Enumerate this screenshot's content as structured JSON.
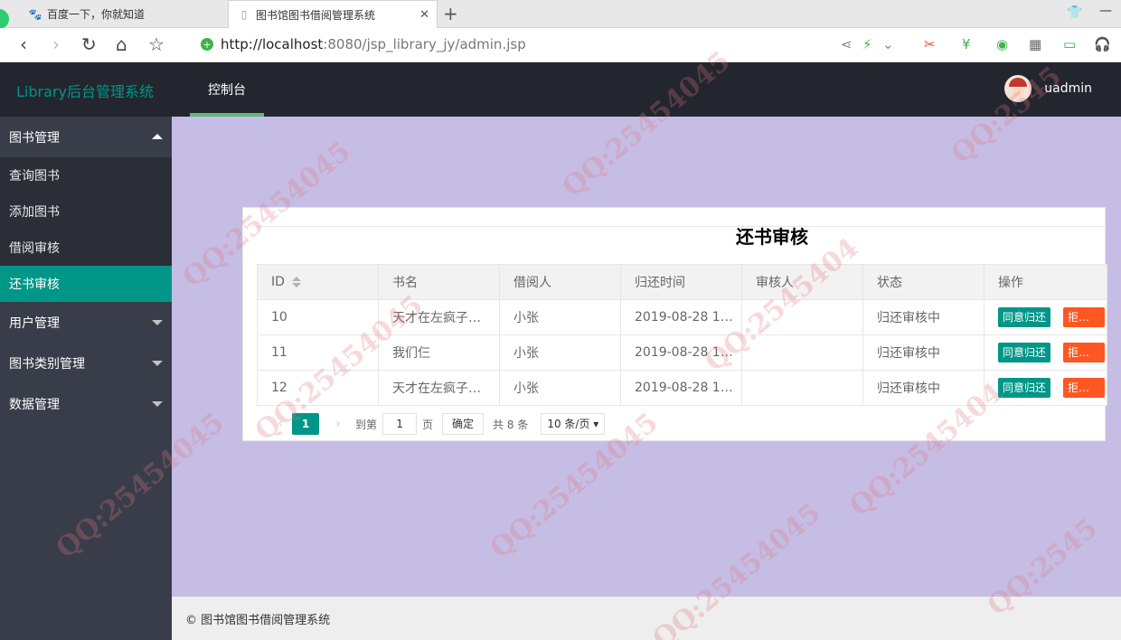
{
  "browser": {
    "tabs": [
      {
        "title": "百度一下，你就知道",
        "active": false,
        "icon": "baidu-paw-icon"
      },
      {
        "title": "图书馆图书借阅管理系统",
        "active": true,
        "icon": "page-icon"
      }
    ],
    "url_host": "http://localhost",
    "url_rest": ":8080/jsp_library_jy/admin.jsp"
  },
  "header": {
    "logo": "Library后台管理系统",
    "nav": "控制台",
    "username": "uadmin"
  },
  "sidebar": {
    "group_books": "图书管理",
    "items": [
      "查询图书",
      "添加图书",
      "借阅审核",
      "还书审核"
    ],
    "active_item": "还书审核",
    "group_users": "用户管理",
    "group_categories": "图书类别管理",
    "group_data": "数据管理"
  },
  "main": {
    "title": "还书审核",
    "columns": [
      "ID",
      "书名",
      "借阅人",
      "归还时间",
      "审核人",
      "状态",
      "操作"
    ],
    "rows": [
      {
        "id": "10",
        "book": "天才在左疯子…",
        "borrower": "小张",
        "time": "2019-08-28 1…",
        "reviewer": "",
        "status": "归还审核中"
      },
      {
        "id": "11",
        "book": "我们仨",
        "borrower": "小张",
        "time": "2019-08-28 1…",
        "reviewer": "",
        "status": "归还审核中"
      },
      {
        "id": "12",
        "book": "天才在左疯子…",
        "borrower": "小张",
        "time": "2019-08-28 1…",
        "reviewer": "",
        "status": "归还审核中"
      }
    ],
    "agree_label": "同意归还",
    "reject_label": "拒…",
    "pager": {
      "current": "1",
      "goto_prefix": "到第",
      "goto_value": "1",
      "goto_suffix": "页",
      "confirm": "确定",
      "total": "共 8 条",
      "page_size": "10 条/页"
    }
  },
  "footer": "© 图书馆图书借阅管理系统",
  "colors": {
    "accent": "#009688",
    "header_bg": "#23262e",
    "sidebar_bg": "#393d49",
    "main_bg": "#c5bde3",
    "reject": "#ff5722"
  }
}
